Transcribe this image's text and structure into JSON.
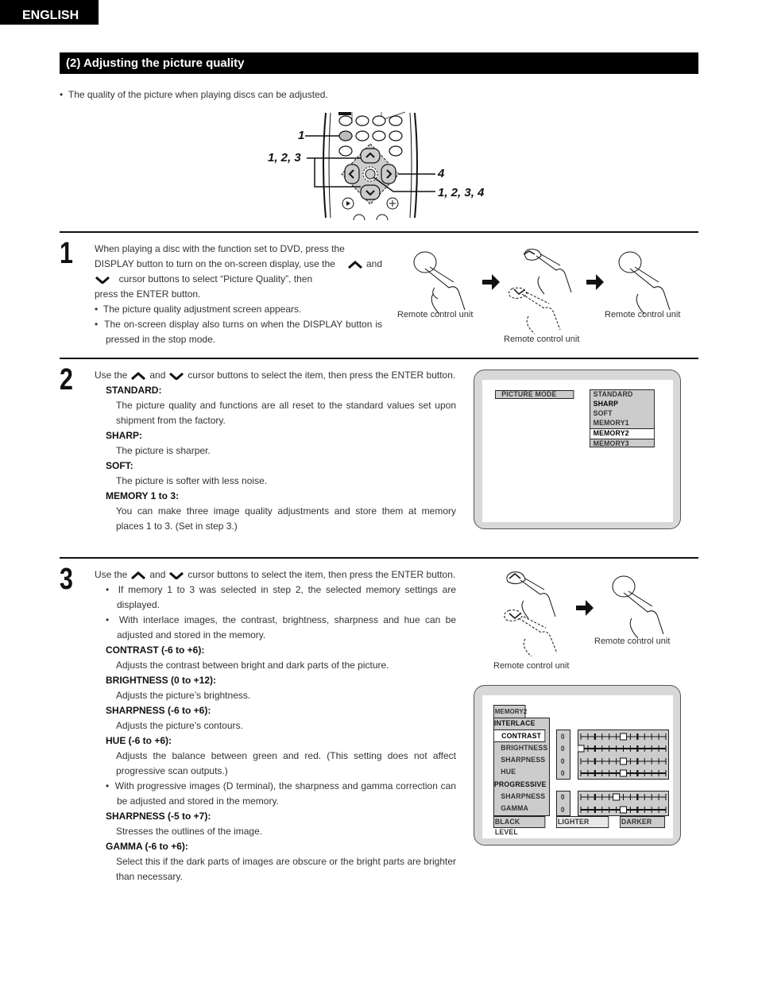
{
  "header": {
    "language_tab": "ENGLISH",
    "section_title": "(2) Adjusting the picture quality",
    "intro": "The quality of the picture when playing discs can be adjusted."
  },
  "remote_diagram": {
    "callouts": [
      "1",
      "1, 2, 3",
      "4",
      "1, 2, 3, 4"
    ]
  },
  "step1": {
    "number": "1",
    "line1": "When playing a disc with the function set to DVD, press the",
    "line2a": "DISPLAY button to turn on the on-screen display, use the",
    "line2b": "and",
    "line3": "cursor buttons to select “Picture Quality”, then",
    "line4": "press the ENTER button.",
    "bullets": [
      "The picture quality adjustment screen appears.",
      "The on-screen display also turns on when the DISPLAY button is pressed in the stop mode."
    ],
    "captions": [
      "Remote control unit",
      "Remote control unit",
      "Remote control unit"
    ]
  },
  "step2": {
    "number": "2",
    "intro_a": "Use the",
    "intro_b": "and",
    "intro_c": "cursor buttons to select the item, then press the ENTER button.",
    "items": [
      {
        "heading": "STANDARD:",
        "desc": "The picture quality and functions are all reset to the standard values set upon shipment from the factory."
      },
      {
        "heading": "SHARP:",
        "desc": "The picture is sharper."
      },
      {
        "heading": "SOFT:",
        "desc": "The picture is softer with less noise."
      },
      {
        "heading": "MEMORY 1 to 3:",
        "desc": "You can make three image quality adjustments and store them at memory places 1 to 3. (Set in step 3.)"
      }
    ],
    "osd": {
      "label": "PICTURE MODE",
      "options": [
        "STANDARD",
        "SHARP",
        "SOFT",
        "MEMORY1",
        "MEMORY2",
        "MEMORY3"
      ],
      "selected": "MEMORY2"
    }
  },
  "step3": {
    "number": "3",
    "intro_a": "Use the",
    "intro_b": "and",
    "intro_c": "cursor buttons to select the item, then press the ENTER button.",
    "bullet1": "If memory 1 to 3 was selected in step 2, the selected memory settings are displayed.",
    "bullet2": "With interlace images, the contrast, brightness, sharpness and hue can be adjusted and stored in the memory.",
    "interlace_items": [
      {
        "heading": "CONTRAST (-6 to +6):",
        "desc": "Adjusts the contrast between bright and dark parts of the picture."
      },
      {
        "heading": "BRIGHTNESS (0 to +12):",
        "desc": "Adjusts the picture’s brightness."
      },
      {
        "heading": "SHARPNESS (-6 to +6):",
        "desc": "Adjusts the picture’s contours."
      },
      {
        "heading": "HUE (-6 to +6):",
        "desc": "Adjusts the balance between green and red. (This setting does not affect progressive scan outputs.)"
      }
    ],
    "bullet3": "With progressive images (D terminal), the sharpness and gamma correction can be adjusted and stored in the memory.",
    "progressive_items": [
      {
        "heading": "SHARPNESS (-5 to +7):",
        "desc": "Stresses the outlines of the image."
      },
      {
        "heading": "GAMMA (-6 to +6):",
        "desc": "Select this if the dark parts of images are obscure or the bright parts are brighter than necessary."
      }
    ],
    "captions": [
      "Remote control unit",
      "Remote control unit"
    ],
    "osd": {
      "memory_label": "MEMORY2",
      "interlace_label": "INTERLACE",
      "progressive_label": "PROGRESSIVE",
      "interlace_rows": [
        {
          "label": "CONTRAST",
          "value": "0",
          "position": 6,
          "selected": true
        },
        {
          "label": "BRIGHTNESS",
          "value": "0",
          "position": 0,
          "selected": false
        },
        {
          "label": "SHARPNESS",
          "value": "0",
          "position": 6,
          "selected": false
        },
        {
          "label": "HUE",
          "value": "0",
          "position": 6,
          "selected": false
        }
      ],
      "progressive_rows": [
        {
          "label": "SHARPNESS",
          "value": "0",
          "position": 5,
          "selected": false
        },
        {
          "label": "GAMMA",
          "value": "0",
          "position": 6,
          "selected": false
        }
      ],
      "slider_steps": 12,
      "black_level_label": "BLACK LEVEL",
      "lighter_label": "LIGHTER",
      "darker_label": "DARKER"
    }
  }
}
